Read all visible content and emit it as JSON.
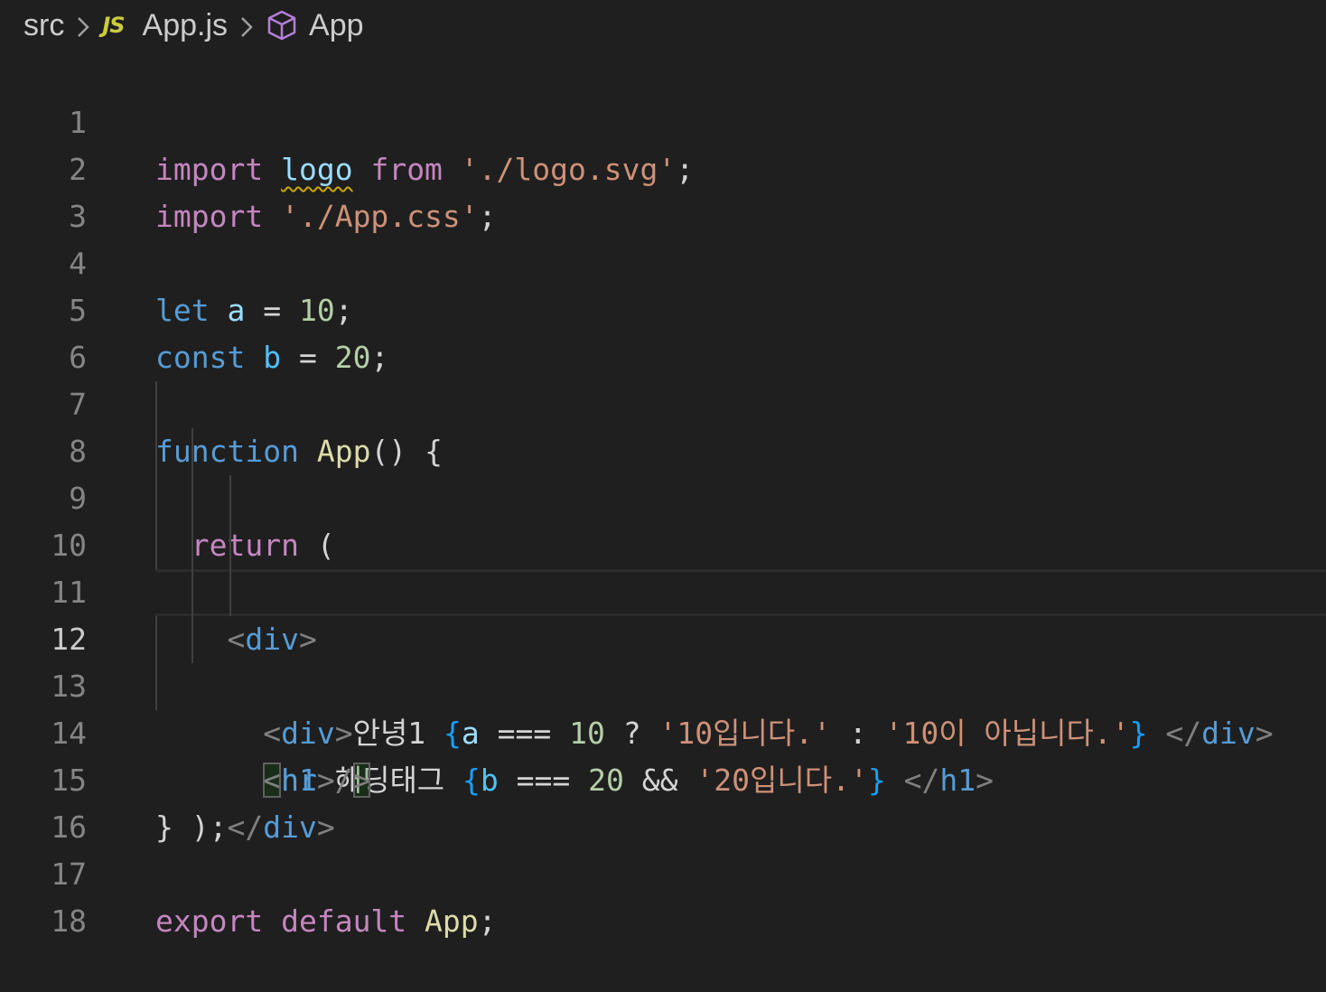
{
  "breadcrumb": {
    "folder": "src",
    "file_badge": "JS",
    "file": "App.js",
    "symbol": "App"
  },
  "colors": {
    "background": "#1f1f1f",
    "keyword_control": "#c586c0",
    "keyword_declaration": "#569cd6",
    "variable": "#9cdcfe",
    "string": "#ce9178",
    "number": "#b5cea8",
    "function": "#dcdcaa",
    "js_badge": "#cbcb41",
    "symbol_icon": "#b180d7",
    "warning_squiggle": "#cca700"
  },
  "editor": {
    "current_line": 12,
    "line_numbers": [
      "1",
      "2",
      "3",
      "4",
      "5",
      "6",
      "7",
      "8",
      "9",
      "10",
      "11",
      "12",
      "13",
      "14",
      "15",
      "16",
      "17",
      "18"
    ],
    "tokens": {
      "import": "import",
      "from": "from",
      "let": "let",
      "const": "const",
      "function": "function",
      "return": "return",
      "export": "export",
      "default": "default",
      "logo": "logo",
      "logo_path": "'./logo.svg'",
      "css_path": "'./App.css'",
      "semi": ";",
      "a": "a",
      "b": "b",
      "eq": "=",
      "ten": "10",
      "twenty": "20",
      "App": "App",
      "parens": "()",
      "open_brace": "{",
      "close_brace": "}",
      "open_paren": "(",
      "close_paren_semi": ");",
      "lt": "<",
      "lt_slash": "</",
      "gt": ">",
      "self_close": "/>",
      "slash": "/",
      "div": "div",
      "h1": "h1",
      "hr": "hr",
      "greeting": "안녕1",
      "heading_text": "해딩태그",
      "strict_eq": "===",
      "question": "?",
      "colon": ":",
      "and": "&&",
      "str_is_10": "'10입니다.'",
      "str_not_10": "'10이 아닙니다.'",
      "str_is_20": "'20입니다.'"
    }
  }
}
